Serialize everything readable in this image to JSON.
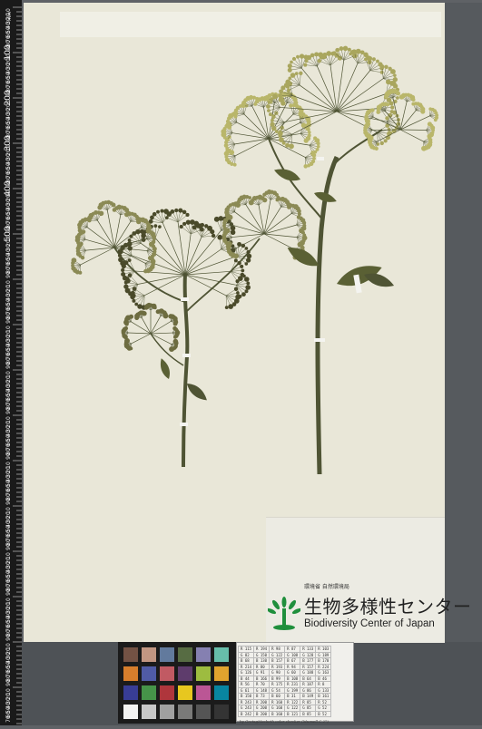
{
  "ruler": {
    "major_labels": [
      "100",
      "200",
      "300",
      "400",
      "500"
    ],
    "minor_labels": [
      "10",
      "20",
      "30",
      "40",
      "50",
      "60",
      "70",
      "80",
      "90"
    ],
    "corner_text": "mm"
  },
  "label": {
    "ministry": "環境省 自然環境局",
    "japanese_name": "生物多様性センター",
    "english_name": "Biodiversity Center of Japan"
  },
  "color_chart": {
    "swatches": [
      "#735244",
      "#c29682",
      "#627a9d",
      "#576c43",
      "#8580b1",
      "#67bdaa",
      "#d67e2c",
      "#505ba6",
      "#c15a63",
      "#5e3c6c",
      "#9dbc40",
      "#e0a32e",
      "#383d96",
      "#469449",
      "#af363c",
      "#e7c71f",
      "#bb5695",
      "#0885a1",
      "#f3f3f2",
      "#c8c8c8",
      "#a0a0a0",
      "#7a7a79",
      "#555555",
      "#343434"
    ]
  },
  "gray_chart": {
    "rows": [
      [
        "R 115",
        "R 194",
        "R 98",
        "R 87",
        "R 133",
        "R 103"
      ],
      [
        "G 82",
        "G 150",
        "G 122",
        "G 108",
        "G 128",
        "G 189"
      ],
      [
        "B 68",
        "B 130",
        "B 157",
        "B 67",
        "B 177",
        "B 170"
      ],
      [
        "R 214",
        "R 80",
        "R 193",
        "R 94",
        "R 157",
        "R 224"
      ],
      [
        "G 126",
        "G 91",
        "G 90",
        "G 60",
        "G 188",
        "G 163"
      ],
      [
        "B 44",
        "B 166",
        "B 99",
        "B 108",
        "B 64",
        "B 46"
      ],
      [
        "R 56",
        "R 70",
        "R 175",
        "R 231",
        "R 187",
        "R 8"
      ],
      [
        "G 61",
        "G 148",
        "G 54",
        "G 199",
        "G 86",
        "G 133"
      ],
      [
        "B 150",
        "B 73",
        "B 60",
        "B 31",
        "B 149",
        "B 161"
      ],
      [
        "R 243",
        "R 200",
        "R 160",
        "R 122",
        "R 85",
        "R 52"
      ],
      [
        "G 243",
        "G 200",
        "G 160",
        "G 122",
        "G 85",
        "G 52"
      ],
      [
        "B 242",
        "B 200",
        "B 160",
        "B 121",
        "B 85",
        "B 52"
      ]
    ],
    "credit": "by GretagMacbeth color checker (Munsell C 2°)"
  },
  "colors": {
    "background": "#5f6266",
    "sheet": "#e9e7d8",
    "stem": "#4f5434",
    "umbel_light": "#b9b66a",
    "umbel_dark": "#4a4a2a",
    "logo_green": "#1f8f3c"
  }
}
